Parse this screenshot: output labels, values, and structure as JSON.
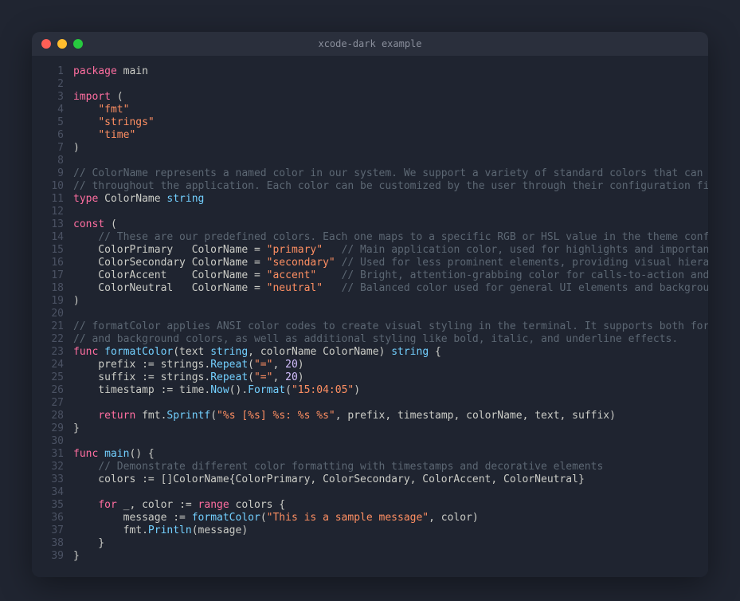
{
  "window": {
    "title": "xcode-dark example"
  },
  "code": {
    "lines": [
      [
        [
          "kw",
          "package"
        ],
        [
          "ident",
          " main"
        ]
      ],
      [],
      [
        [
          "kw",
          "import"
        ],
        [
          "ident",
          " ("
        ]
      ],
      [
        [
          "ident",
          "    "
        ],
        [
          "str",
          "\"fmt\""
        ]
      ],
      [
        [
          "ident",
          "    "
        ],
        [
          "str",
          "\"strings\""
        ]
      ],
      [
        [
          "ident",
          "    "
        ],
        [
          "str",
          "\"time\""
        ]
      ],
      [
        [
          "ident",
          ")"
        ]
      ],
      [],
      [
        [
          "cm",
          "// ColorName represents a named color in our system. We support a variety of standard colors that can be used"
        ]
      ],
      [
        [
          "cm",
          "// throughout the application. Each color can be customized by the user through their configuration file."
        ]
      ],
      [
        [
          "kw",
          "type"
        ],
        [
          "ident",
          " ColorName "
        ],
        [
          "typ",
          "string"
        ]
      ],
      [],
      [
        [
          "kw",
          "const"
        ],
        [
          "ident",
          " ("
        ]
      ],
      [
        [
          "ident",
          "    "
        ],
        [
          "cm",
          "// These are our predefined colors. Each one maps to a specific RGB or HSL value in the theme configuration."
        ]
      ],
      [
        [
          "ident",
          "    ColorPrimary   ColorName = "
        ],
        [
          "str",
          "\"primary\""
        ],
        [
          "ident",
          "   "
        ],
        [
          "cm",
          "// Main application color, used for highlights and important UI elements"
        ]
      ],
      [
        [
          "ident",
          "    ColorSecondary ColorName = "
        ],
        [
          "str",
          "\"secondary\""
        ],
        [
          "ident",
          " "
        ],
        [
          "cm",
          "// Used for less prominent elements, providing visual hierarchy"
        ]
      ],
      [
        [
          "ident",
          "    ColorAccent    ColorName = "
        ],
        [
          "str",
          "\"accent\""
        ],
        [
          "ident",
          "    "
        ],
        [
          "cm",
          "// Bright, attention-grabbing color for calls-to-action and highlights"
        ]
      ],
      [
        [
          "ident",
          "    ColorNeutral   ColorName = "
        ],
        [
          "str",
          "\"neutral\""
        ],
        [
          "ident",
          "   "
        ],
        [
          "cm",
          "// Balanced color used for general UI elements and backgrounds"
        ]
      ],
      [
        [
          "ident",
          ")"
        ]
      ],
      [],
      [
        [
          "cm",
          "// formatColor applies ANSI color codes to create visual styling in the terminal. It supports both foreground"
        ]
      ],
      [
        [
          "cm",
          "// and background colors, as well as additional styling like bold, italic, and underline effects."
        ]
      ],
      [
        [
          "kw",
          "func"
        ],
        [
          "ident",
          " "
        ],
        [
          "fn",
          "formatColor"
        ],
        [
          "ident",
          "(text "
        ],
        [
          "typ",
          "string"
        ],
        [
          "ident",
          ", colorName ColorName) "
        ],
        [
          "typ",
          "string"
        ],
        [
          "ident",
          " {"
        ]
      ],
      [
        [
          "ident",
          "    prefix := strings."
        ],
        [
          "fn",
          "Repeat"
        ],
        [
          "ident",
          "("
        ],
        [
          "str",
          "\"=\""
        ],
        [
          "ident",
          ", "
        ],
        [
          "num",
          "20"
        ],
        [
          "ident",
          ")"
        ]
      ],
      [
        [
          "ident",
          "    suffix := strings."
        ],
        [
          "fn",
          "Repeat"
        ],
        [
          "ident",
          "("
        ],
        [
          "str",
          "\"=\""
        ],
        [
          "ident",
          ", "
        ],
        [
          "num",
          "20"
        ],
        [
          "ident",
          ")"
        ]
      ],
      [
        [
          "ident",
          "    timestamp := time."
        ],
        [
          "fn",
          "Now"
        ],
        [
          "ident",
          "()."
        ],
        [
          "fn",
          "Format"
        ],
        [
          "ident",
          "("
        ],
        [
          "str",
          "\"15:04:05\""
        ],
        [
          "ident",
          ")"
        ]
      ],
      [],
      [
        [
          "ident",
          "    "
        ],
        [
          "kw",
          "return"
        ],
        [
          "ident",
          " fmt."
        ],
        [
          "fn",
          "Sprintf"
        ],
        [
          "ident",
          "("
        ],
        [
          "str",
          "\"%s [%s] %s: %s %s\""
        ],
        [
          "ident",
          ", prefix, timestamp, colorName, text, suffix)"
        ]
      ],
      [
        [
          "ident",
          "}"
        ]
      ],
      [],
      [
        [
          "kw",
          "func"
        ],
        [
          "ident",
          " "
        ],
        [
          "fn",
          "main"
        ],
        [
          "ident",
          "() {"
        ]
      ],
      [
        [
          "ident",
          "    "
        ],
        [
          "cm",
          "// Demonstrate different color formatting with timestamps and decorative elements"
        ]
      ],
      [
        [
          "ident",
          "    colors := []ColorName{ColorPrimary, ColorSecondary, ColorAccent, ColorNeutral}"
        ]
      ],
      [],
      [
        [
          "ident",
          "    "
        ],
        [
          "kw",
          "for"
        ],
        [
          "ident",
          " _, color := "
        ],
        [
          "kw",
          "range"
        ],
        [
          "ident",
          " colors {"
        ]
      ],
      [
        [
          "ident",
          "        message := "
        ],
        [
          "fn",
          "formatColor"
        ],
        [
          "ident",
          "("
        ],
        [
          "str",
          "\"This is a sample message\""
        ],
        [
          "ident",
          ", color)"
        ]
      ],
      [
        [
          "ident",
          "        fmt."
        ],
        [
          "fn",
          "Println"
        ],
        [
          "ident",
          "(message)"
        ]
      ],
      [
        [
          "ident",
          "    }"
        ]
      ],
      [
        [
          "ident",
          "}"
        ]
      ]
    ]
  }
}
